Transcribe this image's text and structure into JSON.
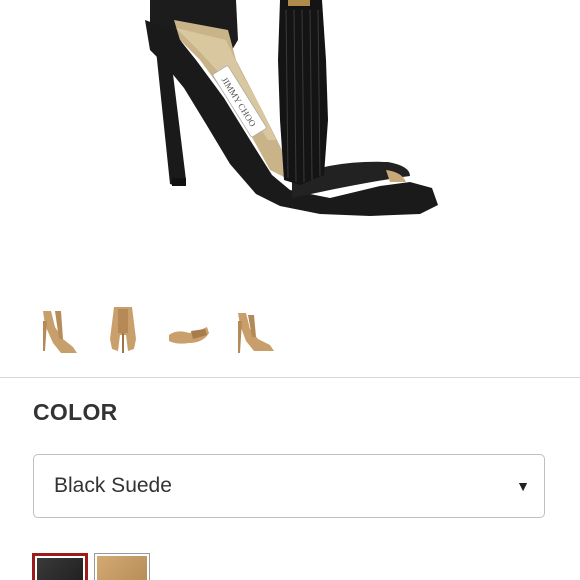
{
  "hero_image": {
    "icon": "black-suede-tassel-sandal-image",
    "brand_imprint": "JIMMY CHOO"
  },
  "thumbnails": [
    {
      "icon": "nude-sandal-side-view-thumbnail"
    },
    {
      "icon": "nude-sandal-back-view-thumbnail"
    },
    {
      "icon": "nude-sandal-sole-view-thumbnail"
    },
    {
      "icon": "nude-sandal-front-view-thumbnail"
    }
  ],
  "color_section": {
    "heading": "COLOR",
    "selected_option": "Black Suede",
    "dropdown_arrow": "▼",
    "swatches": [
      {
        "color": "#2a2a2a",
        "selected": true
      },
      {
        "color": "#c49a62",
        "selected": false
      }
    ],
    "selected_border_color": "#9e1b1b"
  }
}
